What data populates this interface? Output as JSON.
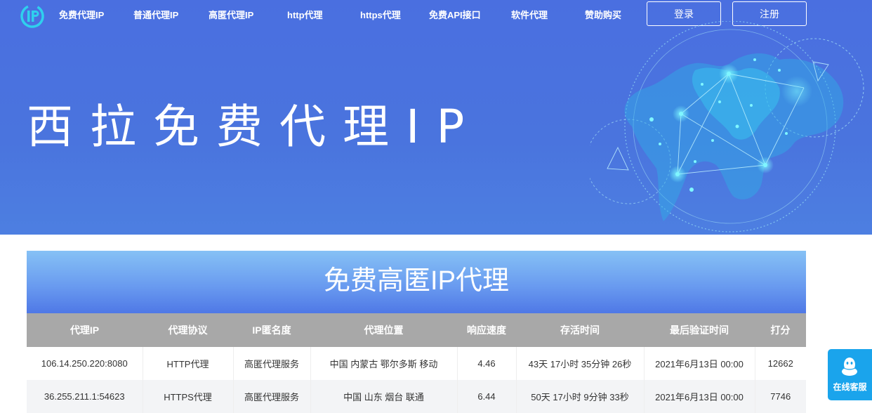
{
  "nav": {
    "items": [
      "免费代理IP",
      "普通代理IP",
      "高匿代理IP",
      "http代理",
      "https代理",
      "免费API接口",
      "软件代理",
      "赞助购买"
    ],
    "login": "登录",
    "register": "注册"
  },
  "hero": {
    "title": "西拉免费代理IP"
  },
  "panel": {
    "title": "免费高匿IP代理"
  },
  "table": {
    "headers": [
      "代理IP",
      "代理协议",
      "IP匿名度",
      "代理位置",
      "响应速度",
      "存活时间",
      "最后验证时间",
      "打分"
    ],
    "rows": [
      [
        "106.14.250.220:8080",
        "HTTP代理",
        "高匿代理服务",
        "中国 内蒙古 鄂尔多斯 移动",
        "4.46",
        "43天 17小时 35分钟 26秒",
        "2021年6月13日 00:00",
        "12662"
      ],
      [
        "36.255.211.1:54623",
        "HTTPS代理",
        "高匿代理服务",
        "中国 山东 烟台 联通",
        "6.44",
        "50天 17小时 9分钟 33秒",
        "2021年6月13日 00:00",
        "7746"
      ]
    ]
  },
  "float": {
    "label": "在线客服",
    "icon": "qq-penguin-icon"
  },
  "colors": {
    "hero_bg": "#4a74de",
    "header_row": "#a8a8a8",
    "float_btn": "#1aa4ec"
  }
}
